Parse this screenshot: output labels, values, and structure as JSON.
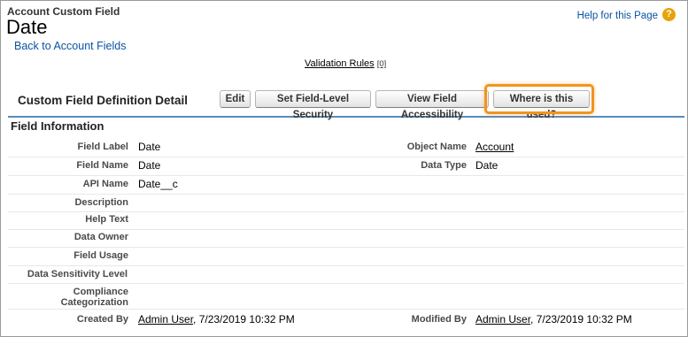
{
  "header": {
    "subtitle": "Account Custom Field",
    "title": "Date",
    "back_link": "Back to Account Fields",
    "help_link": "Help for this Page",
    "help_icon_glyph": "?"
  },
  "validation": {
    "label": "Validation Rules",
    "count": "[0]"
  },
  "detail": {
    "title": "Custom Field Definition Detail",
    "buttons": {
      "edit": "Edit",
      "field_level_security": "Set Field-Level Security",
      "view_accessibility": "View Field Accessibility",
      "where_used": "Where is this used?"
    }
  },
  "section": {
    "title": "Field Information"
  },
  "fields": {
    "field_label": {
      "label": "Field Label",
      "value": "Date"
    },
    "object_name": {
      "label": "Object Name",
      "value": "Account"
    },
    "field_name": {
      "label": "Field Name",
      "value": "Date"
    },
    "data_type": {
      "label": "Data Type",
      "value": "Date"
    },
    "api_name": {
      "label": "API Name",
      "value": "Date__c"
    },
    "description": {
      "label": "Description",
      "value": ""
    },
    "help_text": {
      "label": "Help Text",
      "value": ""
    },
    "data_owner": {
      "label": "Data Owner",
      "value": ""
    },
    "field_usage": {
      "label": "Field Usage",
      "value": ""
    },
    "data_sensitivity": {
      "label": "Data Sensitivity Level",
      "value": ""
    },
    "compliance_line1": {
      "label": "Compliance"
    },
    "compliance_line2": {
      "label": "Categorization",
      "value": ""
    },
    "created_by": {
      "label": "Created By",
      "user": "Admin User",
      "date": ", 7/23/2019 10:32 PM"
    },
    "modified_by": {
      "label": "Modified By",
      "user": "Admin User",
      "date": ", 7/23/2019 10:32 PM"
    }
  },
  "colors": {
    "link": "#0a53a3",
    "highlight": "#f0951e",
    "help_icon": "#e8a20a",
    "section_rule": "#5a8bb8"
  }
}
